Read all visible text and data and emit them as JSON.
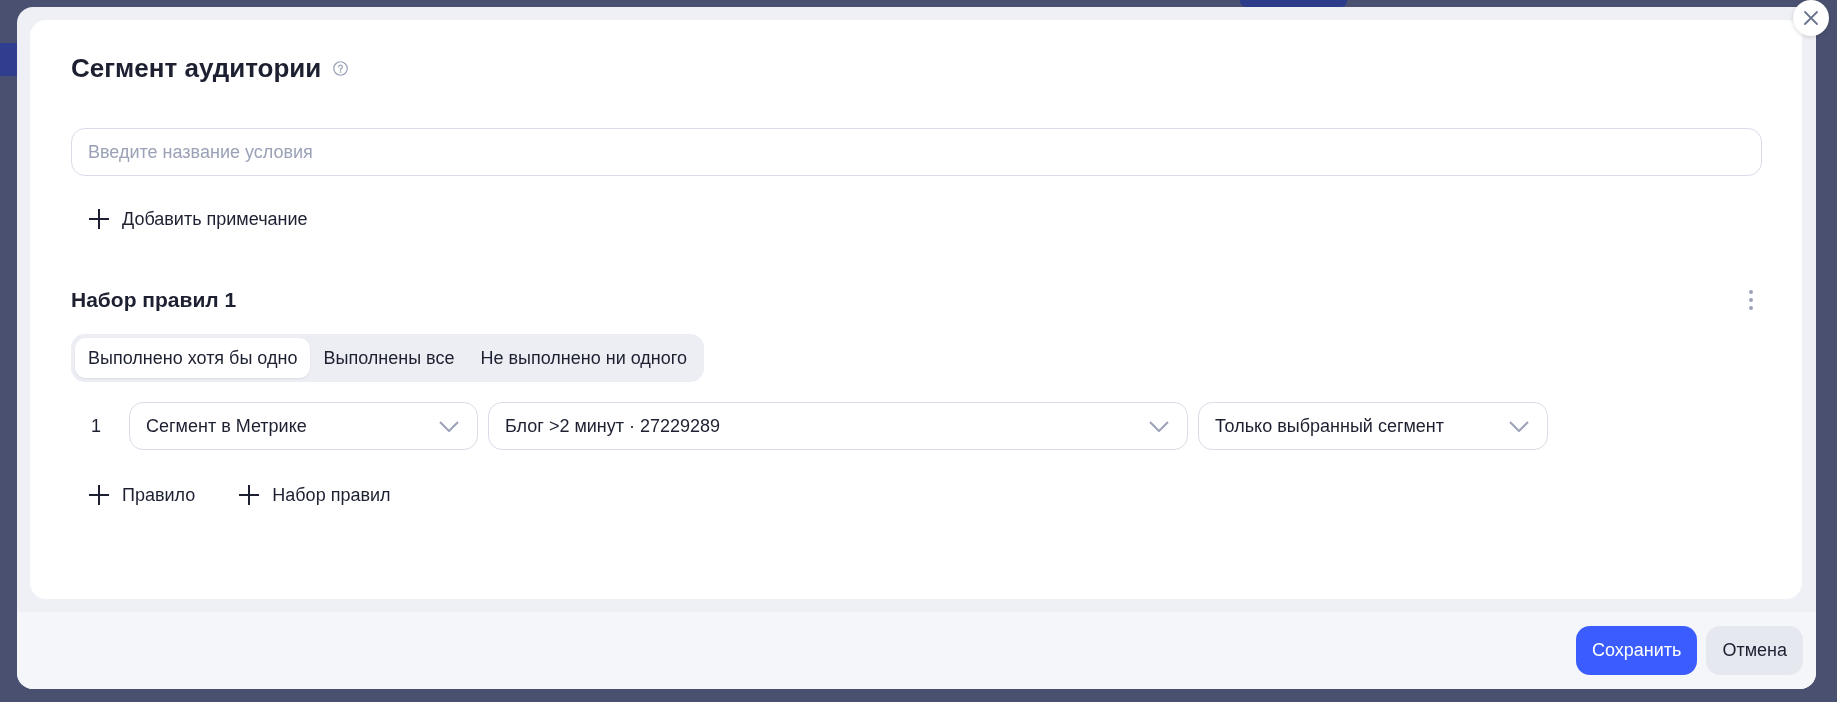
{
  "dialog": {
    "title": "Сегмент аудитории",
    "name_field": {
      "placeholder": "Введите название условия"
    },
    "add_note": {
      "label": "Добавить примечание"
    },
    "rule_sets": [
      {
        "title": "Набор правил 1",
        "modes": [
          {
            "label": "Выполнено хотя бы одно",
            "selected": true
          },
          {
            "label": "Выполнены все",
            "selected": false
          },
          {
            "label": "Не выполнено ни одного",
            "selected": false
          }
        ],
        "rules": [
          {
            "number": "1",
            "fields": [
              {
                "value": "Сегмент в Метрике"
              },
              {
                "value": "Блог >2 минут · 27229289"
              },
              {
                "value": "Только выбранный сегмент"
              }
            ]
          }
        ]
      }
    ],
    "add_actions": [
      {
        "label": "Правило"
      },
      {
        "label": "Набор правил"
      }
    ],
    "buttons": [
      {
        "label": "Сохранить",
        "kind": "primary"
      },
      {
        "label": "Отмена",
        "kind": "secondary"
      }
    ]
  }
}
